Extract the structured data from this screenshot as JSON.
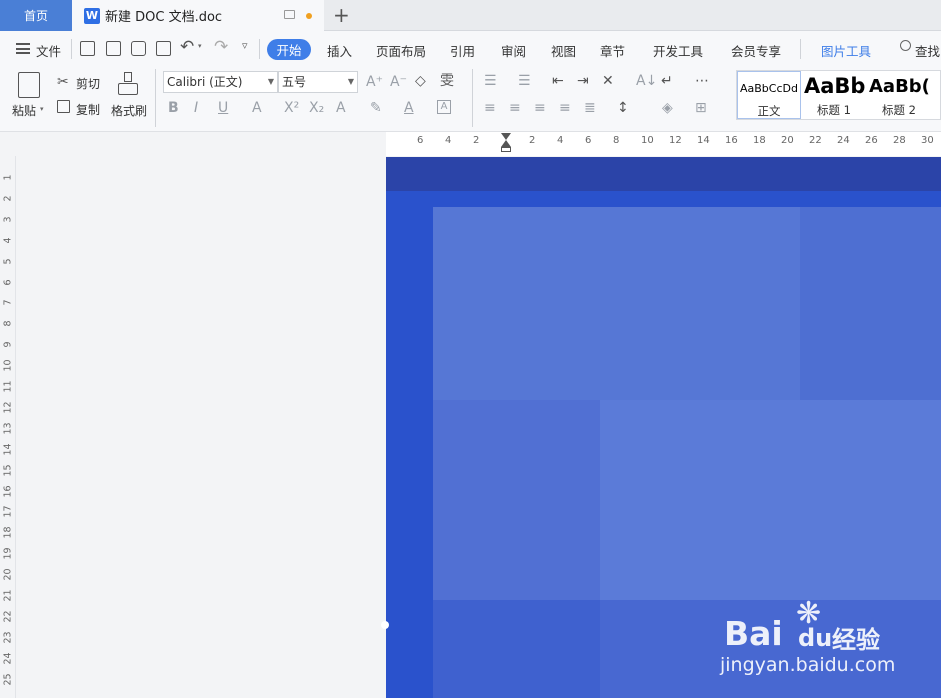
{
  "tabs": {
    "home_label": "首页",
    "doc_logo": "W",
    "doc_title": "新建 DOC 文档.doc",
    "new_tab_symbol": "+"
  },
  "menu": {
    "file_label": "文件",
    "items": [
      "开始",
      "插入",
      "页面布局",
      "引用",
      "审阅",
      "视图",
      "章节",
      "开发工具",
      "会员专享"
    ],
    "picture_tools": "图片工具",
    "search_label": "查找"
  },
  "ribbon": {
    "paste": "粘贴",
    "cut": "剪切",
    "copy": "复制",
    "format_painter": "格式刷",
    "font_name": "Calibri (正文)",
    "font_size": "五号",
    "styles": [
      {
        "sample": "AaBbCcDd",
        "name": "正文"
      },
      {
        "sample": "AaBb",
        "name": "标题 1"
      },
      {
        "sample": "AaBb(",
        "name": "标题 2"
      }
    ]
  },
  "ruler": {
    "horizontal": [
      "6",
      "4",
      "2",
      "2",
      "4",
      "6",
      "8",
      "10",
      "12",
      "14",
      "16",
      "18",
      "20",
      "22",
      "24",
      "26",
      "28",
      "30"
    ],
    "vertical": [
      "1",
      "2",
      "3",
      "4",
      "5",
      "6",
      "7",
      "8",
      "9",
      "10",
      "11",
      "12",
      "13",
      "14",
      "15",
      "16",
      "17",
      "18",
      "19",
      "20",
      "21",
      "22",
      "23",
      "24",
      "25"
    ]
  },
  "watermark": {
    "brand": "Bai",
    "brand_cn": "经验",
    "url": "jingyan.baidu.com"
  },
  "colors": {
    "accent": "#3f7ee8",
    "page_blue": "#2a52cc",
    "panel_light": "#5877d6"
  }
}
